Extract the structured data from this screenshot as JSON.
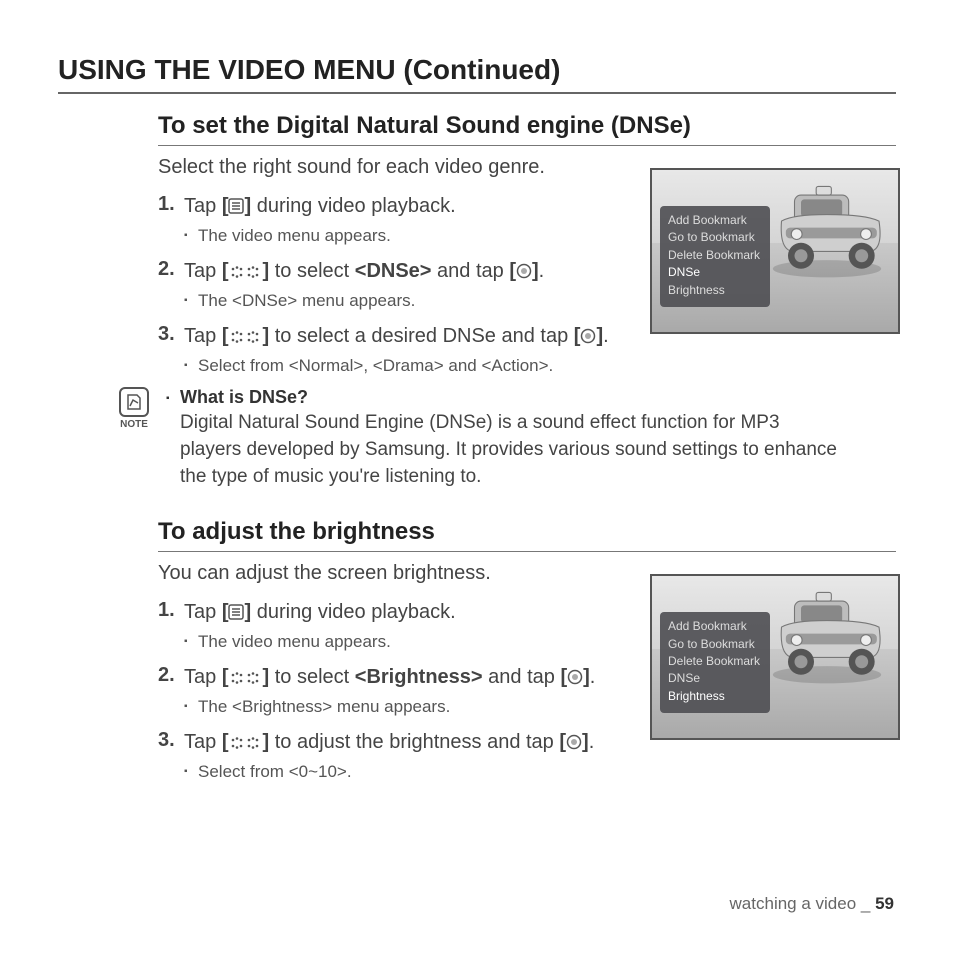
{
  "page_title": "USING THE VIDEO MENU (Continued)",
  "section1": {
    "title": "To set the Digital Natural Sound engine (DNSe)",
    "intro": "Select the right sound for each video genre.",
    "steps": [
      {
        "num": "1.",
        "pre": "Tap ",
        "icon": "menu",
        "post": " during video playback.",
        "sub": "The video menu appears."
      },
      {
        "num": "2.",
        "pre": "Tap ",
        "icon": "updown",
        "mid": " to select ",
        "bold": "<DNSe>",
        "post2": " and tap ",
        "icon2": "ok",
        "end": ".",
        "sub": "The <DNSe> menu appears."
      },
      {
        "num": "3.",
        "pre": "Tap ",
        "icon": "updown",
        "mid": " to select a desired DNSe and tap ",
        "icon2": "ok",
        "end": ".",
        "sub": "Select from <Normal>, <Drama> and <Action>."
      }
    ],
    "note_label": "NOTE",
    "note_title": "What is DNSe?",
    "note_body": "Digital Natural Sound Engine (DNSe) is a sound effect function for MP3 players developed by Samsung. It provides various sound settings to enhance the type of music you're listening to.",
    "menu": [
      "Add Bookmark",
      "Go to Bookmark",
      "Delete Bookmark",
      "DNSe",
      "Brightness"
    ],
    "highlight": "DNSe"
  },
  "section2": {
    "title": "To adjust the brightness",
    "intro": "You can adjust the screen brightness.",
    "steps": [
      {
        "num": "1.",
        "pre": "Tap ",
        "icon": "menu",
        "post": " during video playback.",
        "sub": "The video menu appears."
      },
      {
        "num": "2.",
        "pre": "Tap ",
        "icon": "updown",
        "mid": " to select ",
        "bold": "<Brightness>",
        "post2": " and tap ",
        "icon2": "ok",
        "end": ".",
        "sub": "The <Brightness> menu appears."
      },
      {
        "num": "3.",
        "pre": "Tap ",
        "icon": "updown",
        "mid": " to adjust the brightness and tap ",
        "icon2": "ok",
        "end": ".",
        "sub": "Select from <0~10>."
      }
    ],
    "menu": [
      "Add Bookmark",
      "Go to Bookmark",
      "Delete Bookmark",
      "DNSe",
      "Brightness"
    ],
    "highlight": "Brightness"
  },
  "footer_section": "watching a video",
  "footer_sep": " _ ",
  "footer_page": "59"
}
